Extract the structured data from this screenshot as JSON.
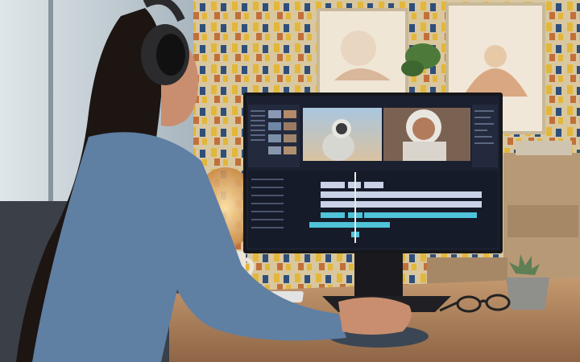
{
  "scene": {
    "subject": "woman-editing-video",
    "colors": {
      "wall_base": "#d9c7a0",
      "wall_yellow": "#e2b73a",
      "wall_blue": "#2f4f7a",
      "wall_orange": "#c2703a",
      "window_light": "#c9d4dc",
      "desk_wood": "#b08660",
      "shirt": "#5f7fa3",
      "hair": "#1c1512",
      "skin": "#c98e6f",
      "monitor_frame": "#16171b",
      "app_bg": "#1b2030",
      "accent_cyan": "#4fc3d9",
      "clip_light": "#c9d2e6"
    }
  }
}
